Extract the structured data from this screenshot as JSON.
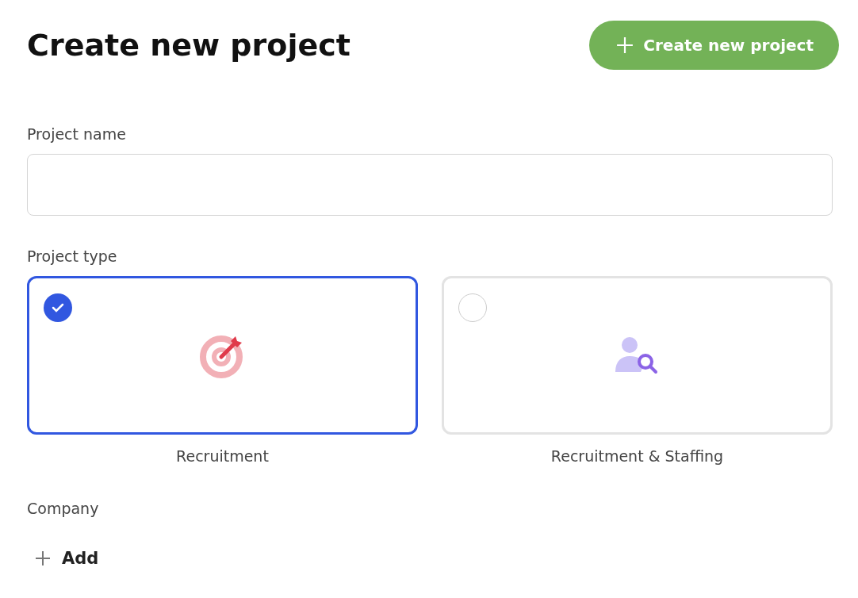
{
  "header": {
    "title": "Create new project",
    "create_button": "Create new project"
  },
  "project_name": {
    "label": "Project name"
  },
  "project_type": {
    "label": "Project type",
    "options": [
      {
        "label": "Recruitment",
        "kind": "target",
        "selected": true
      },
      {
        "label": "Recruitment & Staffing",
        "kind": "person-search",
        "selected": false
      }
    ]
  },
  "company": {
    "label": "Company",
    "add_button": "Add"
  }
}
